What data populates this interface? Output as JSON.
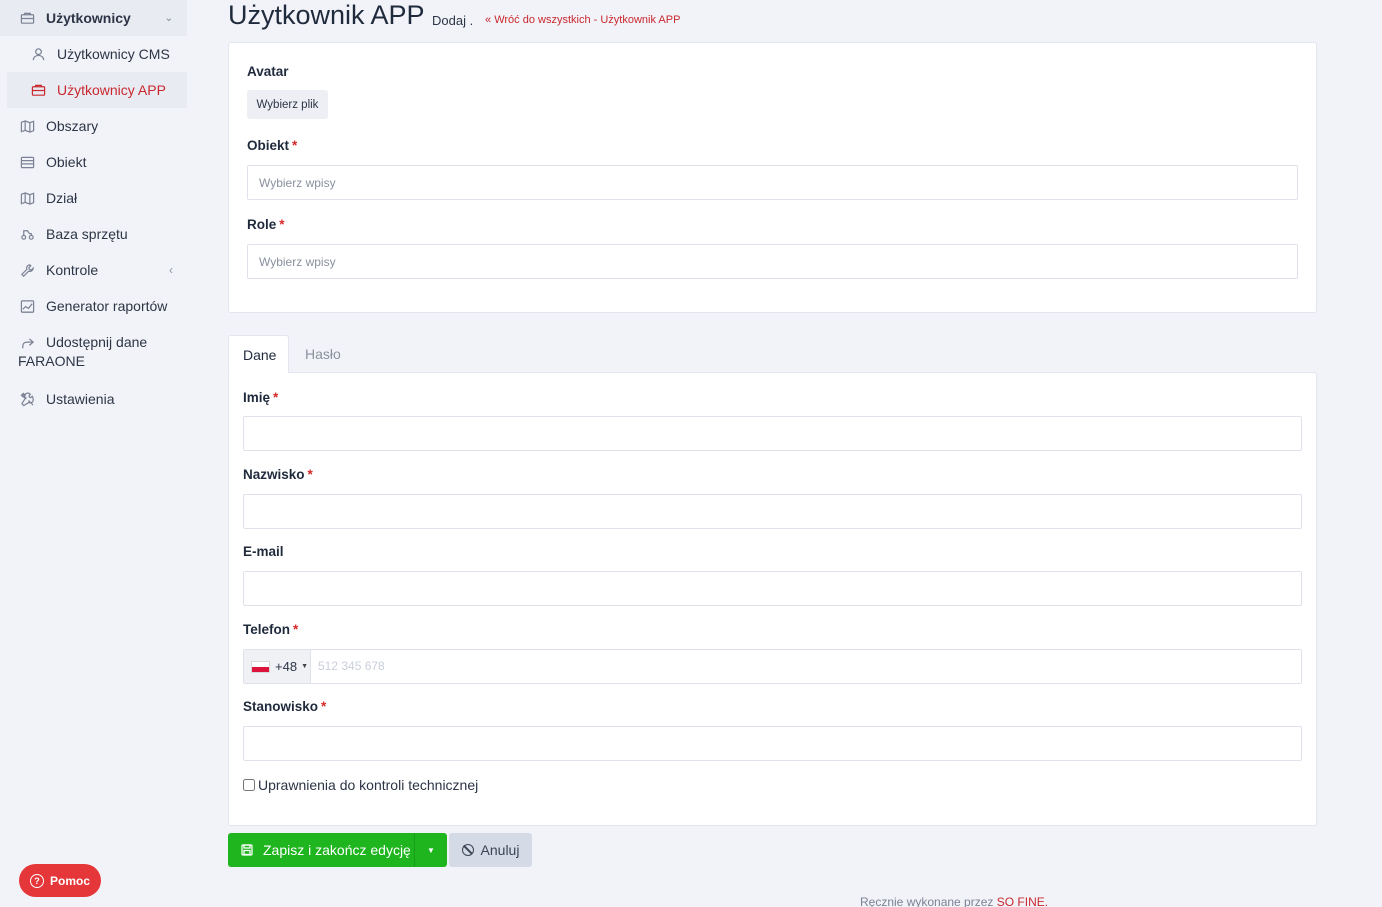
{
  "sidebar": {
    "items": [
      {
        "label": "Użytkownicy"
      },
      {
        "label": "Użytkownicy CMS"
      },
      {
        "label": "Użytkownicy APP"
      },
      {
        "label": "Obszary"
      },
      {
        "label": "Obiekt"
      },
      {
        "label": "Dział"
      },
      {
        "label": "Baza sprzętu"
      },
      {
        "label": "Kontrole"
      },
      {
        "label": "Generator raportów"
      },
      {
        "label_line1": "Udostępnij dane",
        "label_line2": "FARAONE"
      },
      {
        "label": "Ustawienia"
      }
    ],
    "help_label": "Pomoc"
  },
  "header": {
    "title": "Użytkownik APP",
    "subtitle": "Dodaj .",
    "back_link": "Wróć do wszystkich - Użytkownik APP"
  },
  "card1": {
    "avatar_label": "Avatar",
    "file_button": "Wybierz plik",
    "obiekt_label": "Obiekt",
    "obiekt_placeholder": "Wybierz wpisy",
    "role_label": "Role",
    "role_placeholder": "Wybierz wpisy"
  },
  "tabs": [
    {
      "label": "Dane",
      "active": true
    },
    {
      "label": "Hasło",
      "active": false
    }
  ],
  "form": {
    "imie_label": "Imię",
    "nazwisko_label": "Nazwisko",
    "email_label": "E-mail",
    "telefon_label": "Telefon",
    "phone_prefix": "+48",
    "phone_placeholder": "512 345 678",
    "stanowisko_label": "Stanowisko",
    "checkbox_label": "Uprawnienia do kontroli technicznej",
    "required_mark": "*"
  },
  "actions": {
    "save_label": "Zapisz i zakończ edycję",
    "cancel_label": "Anuluj"
  },
  "footer": {
    "text": "Ręcznie wykonane przez",
    "link": "SO FINE."
  },
  "colors": {
    "accent": "#c8282e",
    "save_green": "#1eb51e",
    "help_red": "#e5373a"
  }
}
